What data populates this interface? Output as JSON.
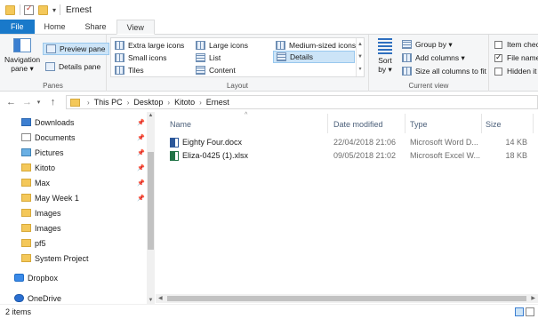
{
  "window": {
    "title": "Ernest"
  },
  "tabs": [
    "File",
    "Home",
    "Share",
    "View"
  ],
  "ribbon": {
    "panes": {
      "nav_pane_label": "Navigation pane",
      "preview_pane_label": "Preview pane",
      "details_pane_label": "Details pane",
      "group_label": "Panes"
    },
    "layout": {
      "items": [
        "Extra large icons",
        "Large icons",
        "Medium-sized icons",
        "Small icons",
        "List",
        "Details",
        "Tiles",
        "Content"
      ],
      "selected": "Details",
      "group_label": "Layout"
    },
    "current_view": {
      "sort_label": "Sort by",
      "group_by_label": "Group by",
      "add_columns_label": "Add columns",
      "size_columns_label": "Size all columns to fit",
      "group_label": "Current view"
    },
    "show_hide": {
      "item_check_boxes_label": "Item check",
      "item_check_boxes_checked": false,
      "file_name_ext_label": "File name",
      "file_name_ext_checked": true,
      "hidden_items_label": "Hidden it",
      "hidden_items_checked": false
    }
  },
  "address": {
    "crumbs": [
      "This PC",
      "Desktop",
      "Kitoto",
      "Ernest"
    ]
  },
  "navigation": {
    "items": [
      {
        "label": "Downloads",
        "icon": "downloads-icon",
        "pinned": true
      },
      {
        "label": "Documents",
        "icon": "documents-icon",
        "pinned": true
      },
      {
        "label": "Pictures",
        "icon": "pictures-icon",
        "pinned": true
      },
      {
        "label": "Kitoto",
        "icon": "folder-icon",
        "pinned": true
      },
      {
        "label": "Max",
        "icon": "folder-icon",
        "pinned": true
      },
      {
        "label": "May Week 1",
        "icon": "folder-icon",
        "pinned": true
      },
      {
        "label": "Images",
        "icon": "folder-icon",
        "pinned": false
      },
      {
        "label": "Images",
        "icon": "folder-icon",
        "pinned": false
      },
      {
        "label": "pf5",
        "icon": "folder-icon",
        "pinned": false
      },
      {
        "label": "System Project",
        "icon": "folder-icon",
        "pinned": false
      }
    ],
    "dropbox_label": "Dropbox",
    "onedrive_label": "OneDrive"
  },
  "filelist": {
    "columns": {
      "name": "Name",
      "date": "Date modified",
      "type": "Type",
      "size": "Size"
    },
    "rows": [
      {
        "name": "Eighty Four.docx",
        "date": "22/04/2018 21:06",
        "type": "Microsoft Word D...",
        "size": "14 KB",
        "icon": "word-doc-icon"
      },
      {
        "name": "Eliza-0425 (1).xlsx",
        "date": "09/05/2018 21:02",
        "type": "Microsoft Excel W...",
        "size": "18 KB",
        "icon": "excel-doc-icon"
      }
    ]
  },
  "status": {
    "item_count": "2 items"
  }
}
